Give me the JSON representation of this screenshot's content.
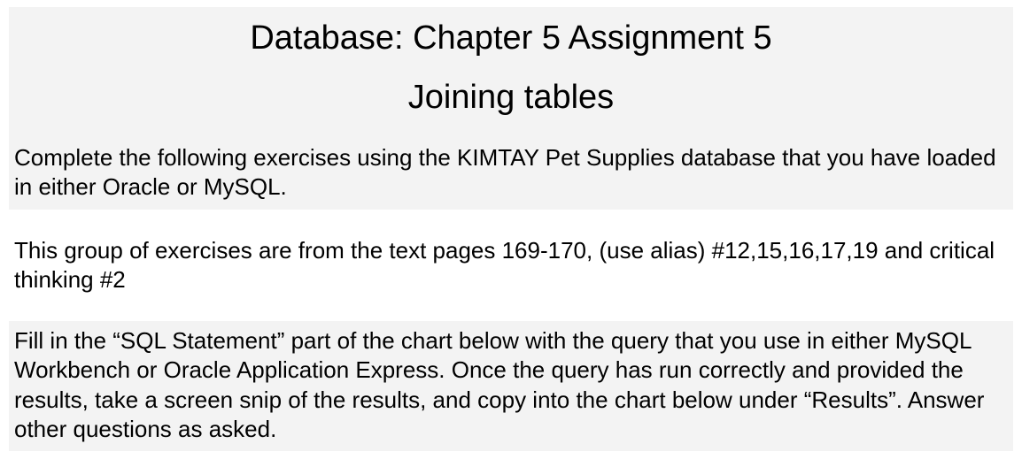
{
  "header": {
    "title": "Database: Chapter 5 Assignment 5",
    "subtitle": "Joining tables"
  },
  "paragraphs": {
    "p1": "Complete the following exercises using the KIMTAY Pet Supplies database that you have loaded in either Oracle or MySQL.",
    "p2": "This group of exercises are from the text pages 169-170, (use alias)  #12,15,16,17,19 and critical thinking #2",
    "p3": "Fill in the “SQL Statement” part of the chart below with the query that you use in either MySQL Workbench or Oracle Application Express.  Once the query has run correctly and provided the results, take a screen snip of the results, and copy into the chart below under “Results”. Answer other questions as asked."
  }
}
